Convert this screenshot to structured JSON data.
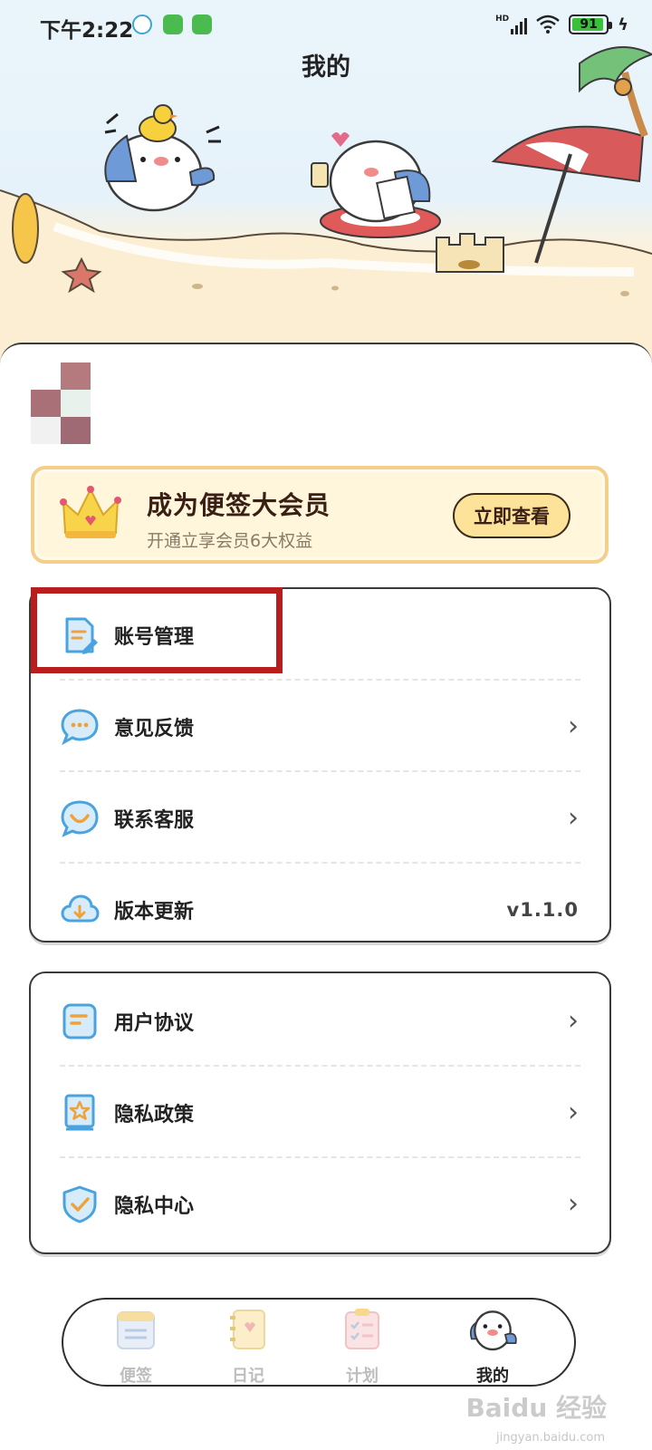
{
  "status_bar": {
    "time": "下午2:22",
    "network_badge": "HD",
    "battery_level": "91"
  },
  "header": {
    "title": "我的"
  },
  "vip_banner": {
    "title": "成为便签大会员",
    "subtitle": "开通立享会员6大权益",
    "button_label": "立即查看"
  },
  "menu_group_1": [
    {
      "label": "账号管理",
      "icon": "document-edit-icon",
      "trailing": ""
    },
    {
      "label": "意见反馈",
      "icon": "chat-bubble-icon",
      "trailing": "›"
    },
    {
      "label": "联系客服",
      "icon": "customer-service-icon",
      "trailing": "›"
    },
    {
      "label": "版本更新",
      "icon": "cloud-download-icon",
      "trailing": "v1.1.0"
    }
  ],
  "menu_group_2": [
    {
      "label": "用户协议",
      "icon": "agreement-doc-icon",
      "trailing": "›"
    },
    {
      "label": "隐私政策",
      "icon": "star-book-icon",
      "trailing": "›"
    },
    {
      "label": "隐私中心",
      "icon": "shield-check-icon",
      "trailing": "›"
    }
  ],
  "bottom_nav": [
    {
      "label": "便签",
      "icon": "notepad-icon",
      "active": false
    },
    {
      "label": "日记",
      "icon": "diary-icon",
      "active": false
    },
    {
      "label": "计划",
      "icon": "plan-checklist-icon",
      "active": false
    },
    {
      "label": "我的",
      "icon": "shark-mascot-icon",
      "active": true
    }
  ],
  "watermark": {
    "text": "Baidu 经验",
    "sub": "jingyan.baidu.com"
  },
  "colors": {
    "highlight_border": "#b81e1e",
    "vip_border": "#f3cf8a",
    "accent_blue": "#4aa3df",
    "accent_orange": "#f0a23a"
  }
}
